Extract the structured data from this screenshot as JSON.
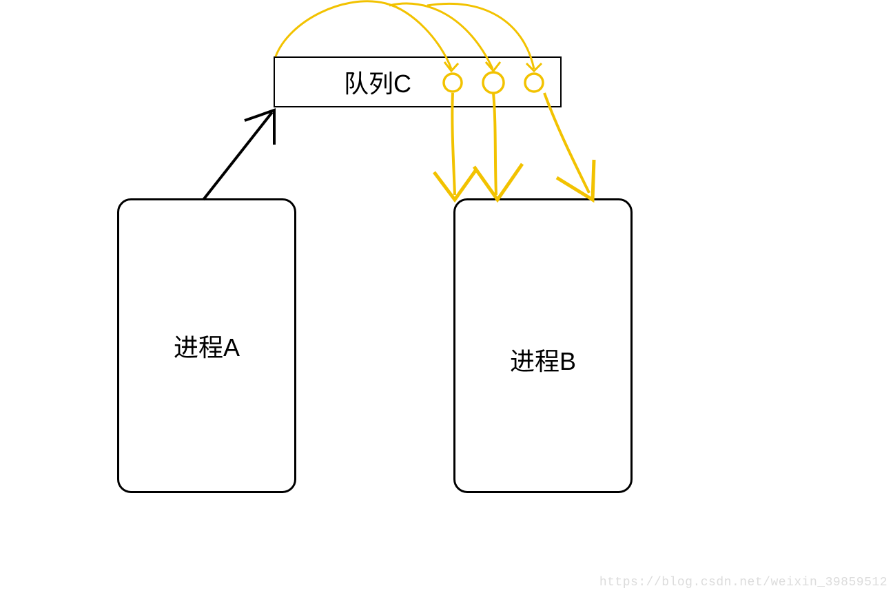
{
  "queue": {
    "label": "队列C"
  },
  "process_a": {
    "label": "进程A"
  },
  "process_b": {
    "label": "进程B"
  },
  "watermark": "https://blog.csdn.net/weixin_39859512",
  "colors": {
    "arrow_black": "#000000",
    "arrow_yellow": "#f2c200",
    "yellow_light": "#f5c300"
  }
}
